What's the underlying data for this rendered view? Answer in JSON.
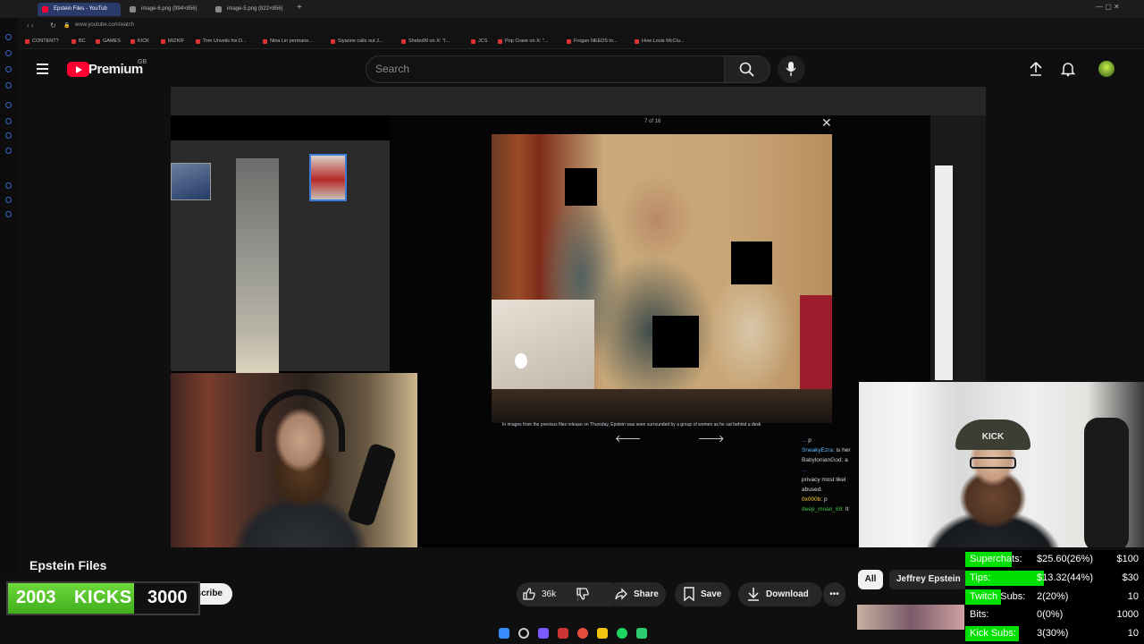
{
  "browser": {
    "tabs": [
      {
        "label": "Epstein Files - YouTub",
        "active": true
      },
      {
        "label": "image-6.png (994×856)",
        "active": false
      },
      {
        "label": "image-5.png (822×856)",
        "active": false
      }
    ],
    "url": "www.youtube.com/watch",
    "bookmarks": [
      "CONTENT?",
      "BC",
      "GAMES",
      "KICK",
      "MIZKIF",
      "Tom Unveils his D...",
      "Nina Lin permane...",
      "Siyanne calls out J...",
      "Shebo99 on X: \"I...",
      "JCS",
      "Pop Crave on X: \"...",
      "Frogan NEEDS to...",
      "How Louis McClu..."
    ]
  },
  "youtube": {
    "logo_text": "Premium",
    "region": "GB",
    "search_placeholder": "Search"
  },
  "video": {
    "counter": "7 of 16",
    "caption": "In images from the previous files release on Thursday, Epstein was seen surrounded by a group of women as he sat behind a desk",
    "chat": [
      {
        "name": "...",
        "text": "p"
      },
      {
        "name": "SneakyEzra:",
        "text": "is her"
      },
      {
        "name": "BabylonianGod:",
        "text": "a"
      },
      {
        "name": "...",
        "text": ""
      },
      {
        "name": "",
        "text": "privacy most likel"
      },
      {
        "name": "",
        "text": "abused."
      },
      {
        "name": "0x000b:",
        "text": "p"
      },
      {
        "name": "deep_moan_69:",
        "text": "It"
      }
    ],
    "webcam_cap_text": "KICK"
  },
  "below": {
    "title": "Epstein Files",
    "kick_current": "2003",
    "kick_label": "KICKS",
    "kick_goal": "3000",
    "kick_progress": 0.668,
    "subscribe_label": "bscribe",
    "likes": "36k",
    "share": "Share",
    "save": "Save",
    "download": "Download",
    "chips": [
      "All",
      "Jeffrey Epstein"
    ]
  },
  "stats": [
    {
      "label": "Superchats:",
      "value": "$25.60(26%)",
      "goal": "$100",
      "progress": 0.26
    },
    {
      "label": "Tips:",
      "value": "$13.32(44%)",
      "goal": "$30",
      "progress": 0.44
    },
    {
      "label": "Twitch Subs:",
      "value": "2(20%)",
      "goal": "10",
      "progress": 0.2
    },
    {
      "label": "Bits:",
      "value": "0(0%)",
      "goal": "1000",
      "progress": 0
    },
    {
      "label": "Kick Subs:",
      "value": "3(30%)",
      "goal": "10",
      "progress": 0.3
    }
  ],
  "colors": {
    "youtube_red": "#ff0033",
    "kick_green": "#53fc18",
    "progress_green": "#00e000",
    "background": "#0f0f0f"
  }
}
